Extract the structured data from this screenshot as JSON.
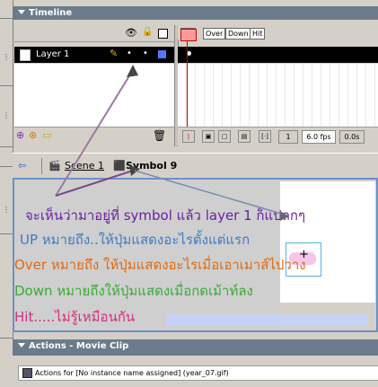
{
  "timeline": {
    "title": "Timeline",
    "layer_name": "Layer 1",
    "frame_labels": [
      "Up",
      "Over",
      "Down",
      "Hit"
    ],
    "current_frame": "1",
    "frame_rate": "6.0 fps",
    "elapsed_time": "0.0s"
  },
  "edit_bar": {
    "scene": "Scene 1",
    "symbol": "Symbol 9"
  },
  "stage_text": {
    "line1": "จะเห็นว่ามาอยู่ที่ symbol แล้ว layer 1 ก็แปลกๆ",
    "line2": "UP หมายถึง..ให้ปุ่มแสดงอะไรตั้งแต่แรก",
    "line3": "Over หมายถึง ให้ปุ่มแสดงอะไรเมื่อเอาเมาส์ไปวาง",
    "line4": "Down หมายถึงให้ปุ่มแสดงเมื่อกดเม้าท์ลง",
    "line5": "Hit.....ไม่รู้เหมือนกัน"
  },
  "colors": {
    "line1": "#6a1fa0",
    "line2": "#3e7bc8",
    "line3": "#e06a10",
    "line4": "#3aaa35",
    "line5": "#d0307f",
    "stage_border": "#6b8fcf",
    "arrows": "#7a4a8a"
  },
  "actions": {
    "title": "Actions - Movie Clip",
    "target_text": "Actions for [No instance name assigned] (year_07.gif)"
  }
}
